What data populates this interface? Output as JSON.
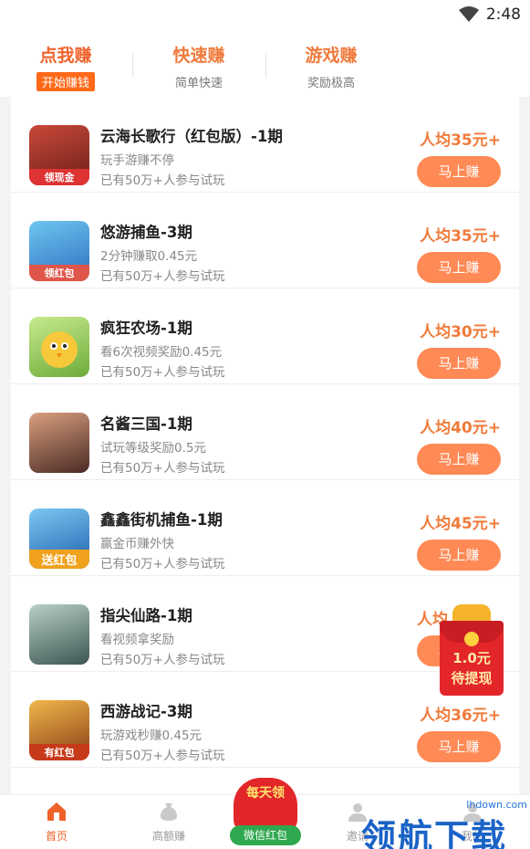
{
  "status_bar": {
    "time": "2:48"
  },
  "tabs": [
    {
      "title": "点我赚",
      "subtitle": "开始赚钱"
    },
    {
      "title": "快速赚",
      "subtitle": "简单快速"
    },
    {
      "title": "游戏赚",
      "subtitle": "奖励极高"
    }
  ],
  "items": [
    {
      "name": "云海长歌行（红包版）-1期",
      "desc": "玩手游赚不停",
      "count": "已有50万+人参与试玩",
      "avg": "人均35元+",
      "button": "马上赚",
      "thumb_label": "领现金",
      "thumb_color": "#8a2a1e"
    },
    {
      "name": "悠游捕鱼-3期",
      "desc": "2分钟赚取0.45元",
      "count": "已有50万+人参与试玩",
      "avg": "人均35元+",
      "button": "马上赚",
      "thumb_label": "领红包",
      "thumb_color": "#2f8fd6"
    },
    {
      "name": "疯狂农场-1期",
      "desc": "看6次视频奖励0.45元",
      "count": "已有50万+人参与试玩",
      "avg": "人均30元+",
      "button": "马上赚",
      "thumb_label": "",
      "thumb_color": "#8fcf52"
    },
    {
      "name": "名酱三国-1期",
      "desc": "试玩等级奖励0.5元",
      "count": "已有50万+人参与试玩",
      "avg": "人均40元+",
      "button": "马上赚",
      "thumb_label": "",
      "thumb_color": "#5a3b33"
    },
    {
      "name": "鑫鑫街机捕鱼-1期",
      "desc": "赢金币赚外快",
      "count": "已有50万+人参与试玩",
      "avg": "人均45元+",
      "button": "马上赚",
      "thumb_label": "送红包",
      "thumb_color": "#1f73c4"
    },
    {
      "name": "指尖仙路-1期",
      "desc": "看视频拿奖励",
      "count": "已有50万+人参与试玩",
      "avg": "人均",
      "button": "马上赚",
      "thumb_label": "",
      "thumb_color": "#6a8a8c"
    },
    {
      "name": "西游战记-3期",
      "desc": "玩游戏秒赚0.45元",
      "count": "已有50万+人参与试玩",
      "avg": "人均36元+",
      "button": "马上赚",
      "thumb_label": "有红包",
      "thumb_color": "#b5571f"
    }
  ],
  "floating_packet": {
    "amount": "1.0元",
    "status": "待提现"
  },
  "center_button": {
    "top": "每天领",
    "label": "微信红包"
  },
  "nav": [
    {
      "label": "首页",
      "icon": "home-icon"
    },
    {
      "label": "高额赚",
      "icon": "money-bag-icon"
    },
    {
      "label": "邀请",
      "icon": "user-icon"
    },
    {
      "label": "我的",
      "icon": "profile-icon"
    }
  ],
  "watermark": {
    "url": "lhdown.com",
    "brand": "领航下载"
  },
  "colors": {
    "accent": "#f07a3a",
    "button": "#ff8a55",
    "packet": "#e3262a"
  }
}
